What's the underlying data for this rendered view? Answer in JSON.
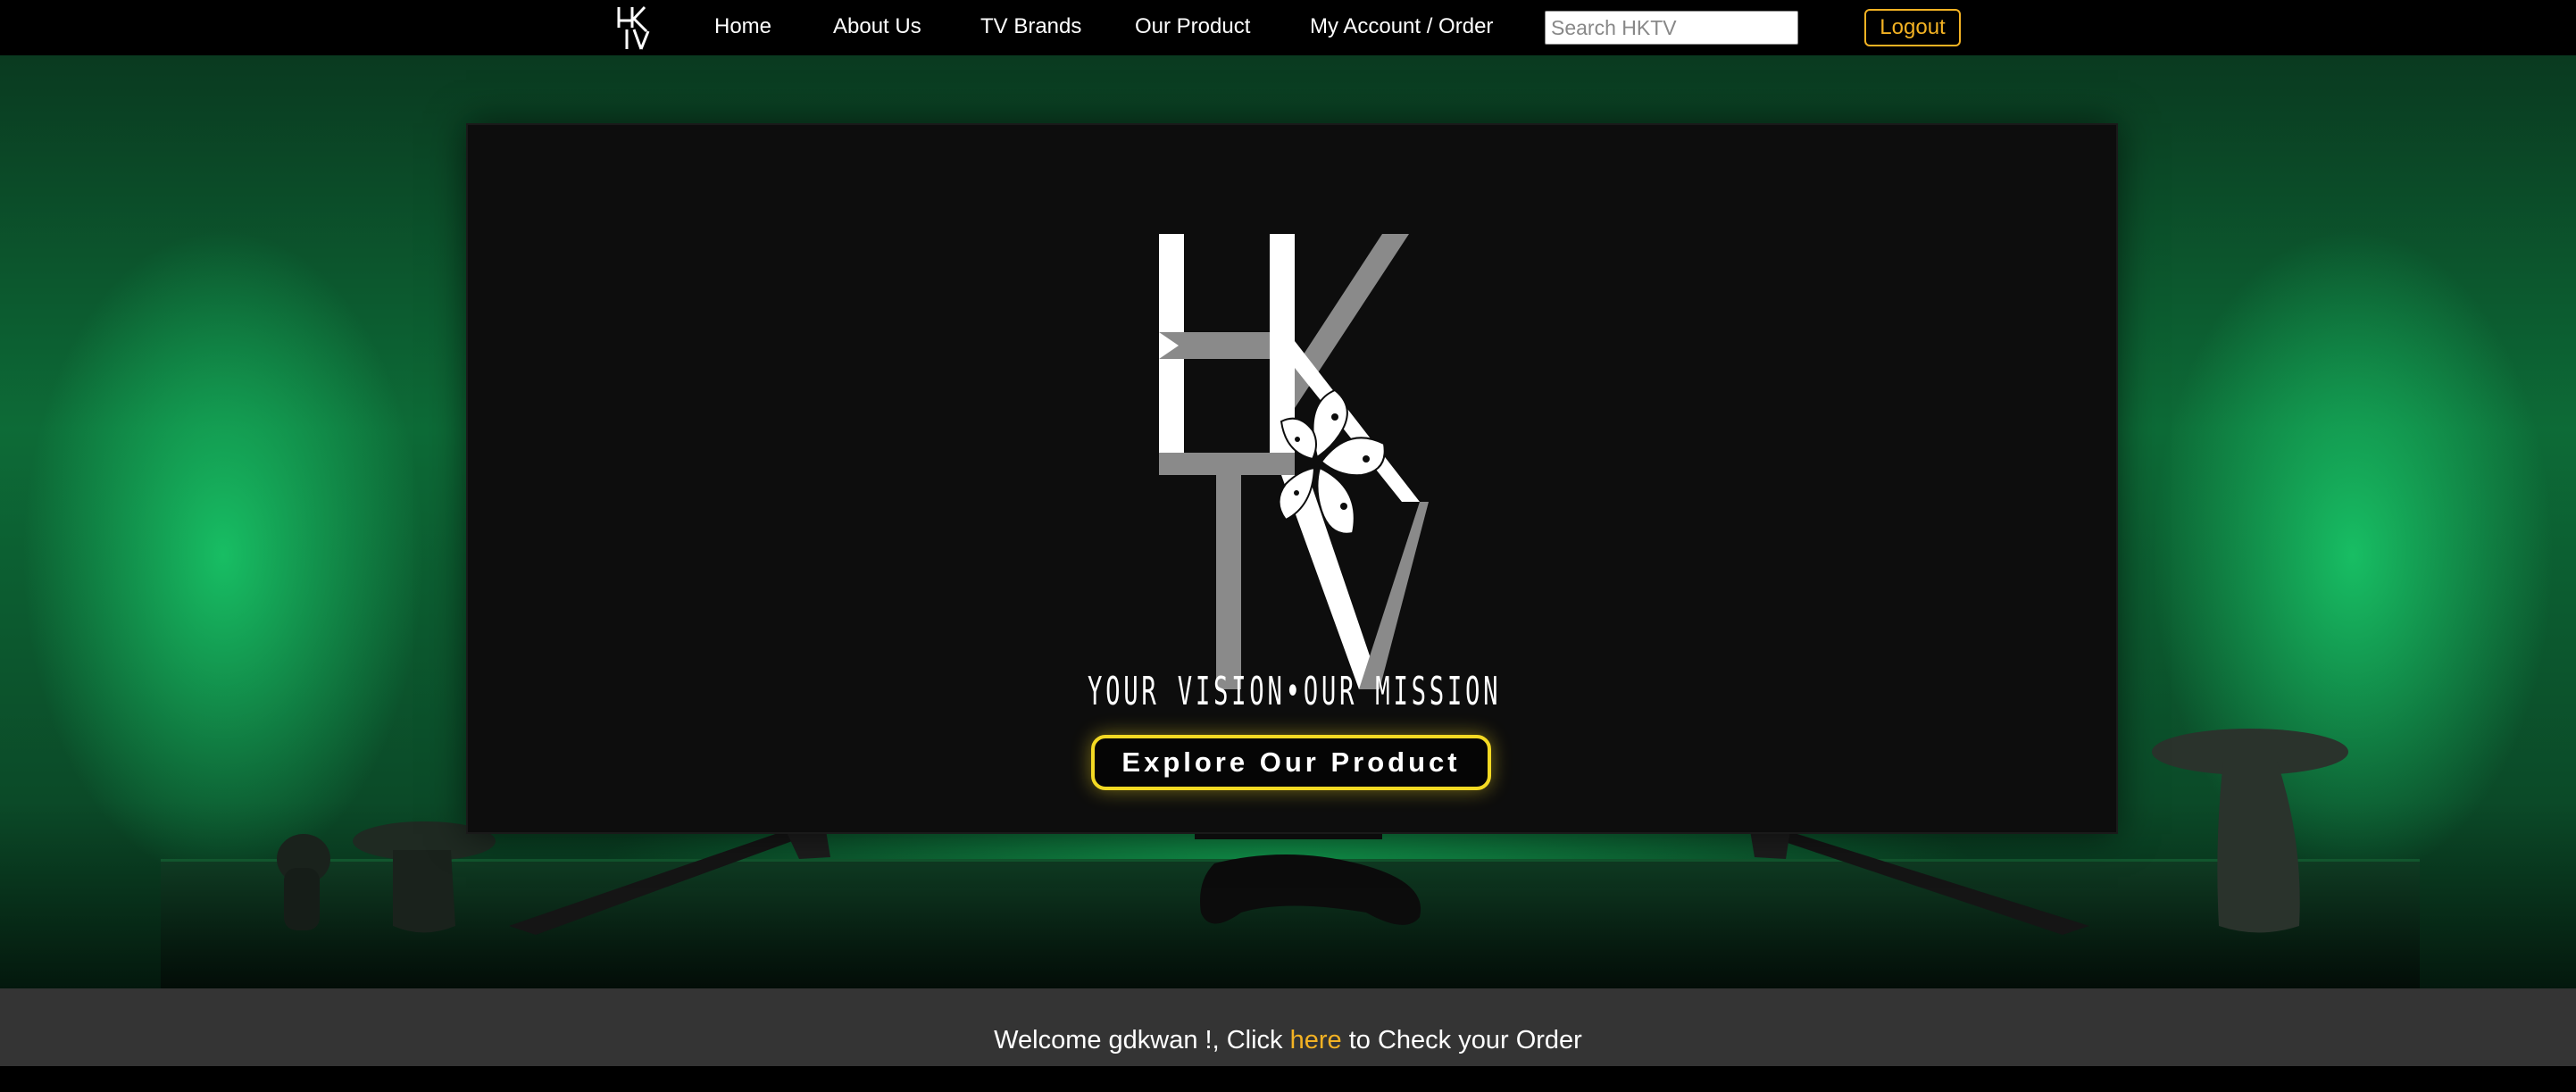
{
  "nav": {
    "logo_text": "HKTV",
    "links": [
      "Home",
      "About Us",
      "TV Brands",
      "Our Product",
      "My Account / Order"
    ],
    "search_placeholder": "Search HKTV",
    "logout_label": "Logout"
  },
  "hero": {
    "tagline": "YOUR VISION•OUR MISSION",
    "cta_label": "Explore Our Product"
  },
  "footer": {
    "welcome_prefix": "Welcome gdkwan !, Click ",
    "link_text": "here",
    "welcome_suffix": " to Check your Order"
  },
  "colors": {
    "nav_bg": "#000000",
    "accent_orange": "#f3b223",
    "cta_border": "#f3d923",
    "ambient_green": "#19c869",
    "footer_bg": "#343434"
  }
}
